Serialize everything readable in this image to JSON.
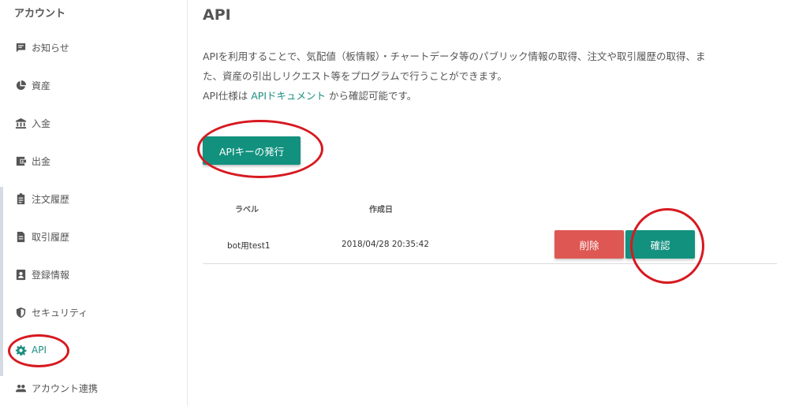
{
  "sidebar": {
    "title": "アカウント",
    "items": [
      {
        "label": "お知らせ",
        "icon": "message-icon"
      },
      {
        "label": "資産",
        "icon": "pie-chart-icon"
      },
      {
        "label": "入金",
        "icon": "bank-icon"
      },
      {
        "label": "出金",
        "icon": "wallet-icon"
      },
      {
        "label": "注文履歴",
        "icon": "clipboard-icon"
      },
      {
        "label": "取引履歴",
        "icon": "document-icon"
      },
      {
        "label": "登録情報",
        "icon": "contact-card-icon"
      },
      {
        "label": "セキュリティ",
        "icon": "shield-icon"
      },
      {
        "label": "API",
        "icon": "gear-icon",
        "active": true
      },
      {
        "label": "アカウント連携",
        "icon": "people-icon"
      }
    ]
  },
  "main": {
    "title": "API",
    "description_line1": "APIを利用することで、気配値（板情報）・チャートデータ等のパブリック情報の取得、注文や取引履歴の取得、ま",
    "description_line2": "た、資産の引出しリクエスト等をプログラムで行うことができます。",
    "description_line3_prefix": "API仕様は ",
    "description_link": "APIドキュメント",
    "description_line3_suffix": " から確認可能です。",
    "issue_button": "APIキーの発行",
    "table": {
      "headers": [
        "ラベル",
        "作成日"
      ],
      "rows": [
        {
          "label": "bot用test1",
          "created": "2018/04/28 20:35:42",
          "delete": "削除",
          "confirm": "確認"
        }
      ]
    }
  },
  "colors": {
    "accent": "#12917f",
    "danger": "#de5753",
    "annotation": "#d71920"
  }
}
